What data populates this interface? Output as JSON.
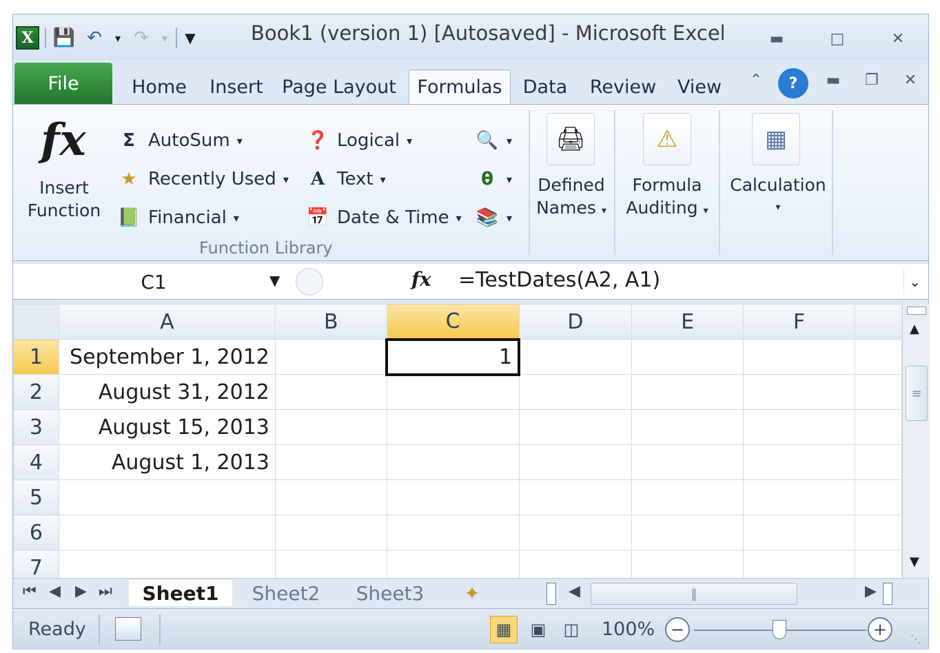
{
  "window": {
    "title": "Book1 (version 1) [Autosaved]  -  Microsoft Excel",
    "app_icon": "X"
  },
  "tabs": [
    "File",
    "Home",
    "Insert",
    "Page Layout",
    "Formulas",
    "Data",
    "Review",
    "View"
  ],
  "active_tab": "Formulas",
  "ribbon": {
    "insert_function": {
      "icon": "fx",
      "label_line1": "Insert",
      "label_line2": "Function"
    },
    "function_library": {
      "autosum": "AutoSum",
      "recently_used": "Recently Used",
      "financial": "Financial",
      "logical": "Logical",
      "text": "Text",
      "date_time": "Date & Time",
      "group_label": "Function Library"
    },
    "defined_names": {
      "line1": "Defined",
      "line2": "Names"
    },
    "formula_auditing": {
      "line1": "Formula",
      "line2": "Auditing"
    },
    "calculation": {
      "label": "Calculation"
    }
  },
  "formula_bar": {
    "name_box": "C1",
    "fx_label": "fx",
    "formula": "=TestDates(A2, A1)"
  },
  "grid": {
    "columns": [
      "A",
      "B",
      "C",
      "D",
      "E",
      "F"
    ],
    "selected_column": "C",
    "selected_row": "1",
    "rows": [
      {
        "num": "1",
        "cells": [
          "September 1, 2012",
          "",
          "1",
          "",
          "",
          ""
        ]
      },
      {
        "num": "2",
        "cells": [
          "August 31, 2012",
          "",
          "",
          "",
          "",
          ""
        ]
      },
      {
        "num": "3",
        "cells": [
          "August 15, 2013",
          "",
          "",
          "",
          "",
          ""
        ]
      },
      {
        "num": "4",
        "cells": [
          "August 1, 2013",
          "",
          "",
          "",
          "",
          ""
        ]
      },
      {
        "num": "5",
        "cells": [
          "",
          "",
          "",
          "",
          "",
          ""
        ]
      },
      {
        "num": "6",
        "cells": [
          "",
          "",
          "",
          "",
          "",
          ""
        ]
      },
      {
        "num": "7",
        "cells": [
          "",
          "",
          "",
          "",
          "",
          ""
        ]
      }
    ]
  },
  "sheets": [
    "Sheet1",
    "Sheet2",
    "Sheet3"
  ],
  "active_sheet": "Sheet1",
  "status": {
    "ready": "Ready",
    "zoom": "100%"
  }
}
